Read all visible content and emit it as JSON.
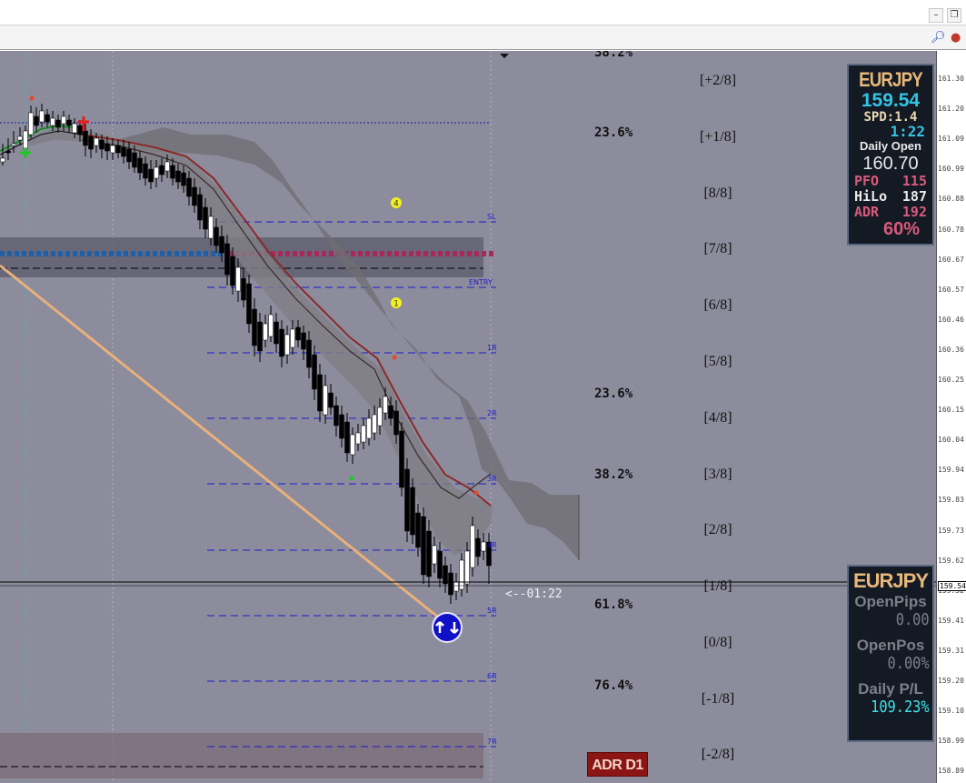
{
  "window": {
    "minimize_label": "–",
    "restore_label": "❐",
    "search_icon": "search-icon",
    "alert_icon": "alert-icon"
  },
  "chart": {
    "background": "#8d8c9c",
    "price_labels": [
      "161.30",
      "161.20",
      "161.09",
      "160.99",
      "160.88",
      "160.78",
      "160.67",
      "160.57",
      "160.46",
      "160.36",
      "160.25",
      "160.15",
      "160.04",
      "159.94",
      "159.83",
      "159.73",
      "159.62",
      "159.52",
      "159.41",
      "159.31",
      "159.20",
      "159.10",
      "158.99",
      "158.89"
    ],
    "current_price_label": "159.54",
    "murrey_levels": [
      "[+2/8]",
      "[+1/8]",
      "[8/8]",
      "[7/8]",
      "[6/8]",
      "[5/8]",
      "[4/8]",
      "[3/8]",
      "[2/8]",
      "[1/8]",
      "[0/8]",
      "[-1/8]",
      "[-2/8]"
    ],
    "fib_labels": {
      "top_cut": "38.2%",
      "a": "23.6%",
      "b": "23.6%",
      "c": "38.2%",
      "d": "61.8%",
      "e": "76.4%"
    },
    "level_labels": {
      "sl": "SL",
      "entry": "ENTRY",
      "r1": "1R",
      "r2": "2R",
      "r3": "3R",
      "r4": "4R",
      "r5": "5R",
      "r6": "6R",
      "r7": "7R"
    },
    "countdown": "<--01:22",
    "markers": {
      "four": "4",
      "one": "1"
    },
    "adr_badge": "ADR D1"
  },
  "info_panel": {
    "symbol": "EURJPY",
    "bid": "159.54",
    "spread": "SPD:1.4",
    "timer": "1:22",
    "daily_open_label": "Daily Open",
    "daily_open": "160.70",
    "pfo_label": "PFO",
    "pfo": "115",
    "hilo_label": "HiLo",
    "hilo": "187",
    "adr_label": "ADR",
    "adr": "192",
    "adr_pct": "60%"
  },
  "account_panel": {
    "symbol": "EURJPY",
    "open_pips_label": "OpenPips",
    "open_pips": "0.00",
    "open_pos_label": "OpenPos",
    "open_pos": "0.00%",
    "daily_pl_label": "Daily P/L",
    "daily_pl": "109.23%"
  },
  "colors": {
    "bull": "#ffffff",
    "bear": "#000000",
    "kijun": "#8a2a2a",
    "green_ma": "#1a8a2a",
    "fib_line": "#e8b07a",
    "level_line": "#1a1ad0",
    "dotted_red": "#a8285a",
    "dotted_blue": "#1d5fa8"
  }
}
